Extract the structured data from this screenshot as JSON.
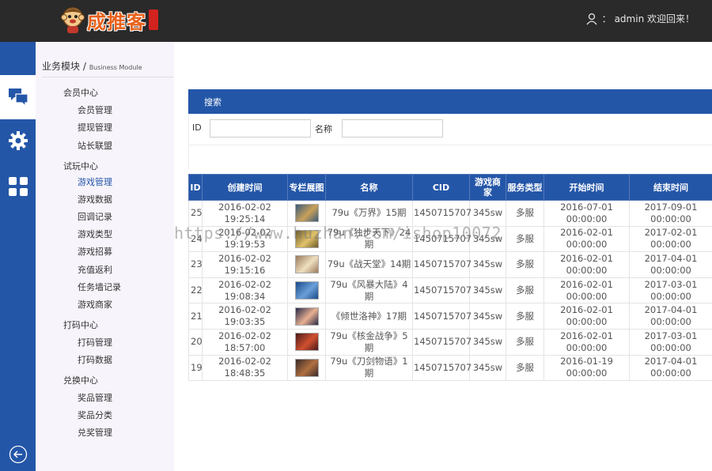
{
  "header": {
    "logo_text": "成推客",
    "user_text": "admin 欢迎回来！",
    "user_prefix": "："
  },
  "sidebar": {
    "title": "业务模块 /",
    "subtitle": "Business Module",
    "groups": [
      {
        "label": "会员中心",
        "items": [
          "会员管理",
          "提现管理",
          "站长联盟"
        ]
      },
      {
        "label": "试玩中心",
        "items": [
          "游戏管理",
          "游戏数据",
          "回调记录",
          "游戏类型",
          "游戏招募",
          "充值返利",
          "任务墙记录",
          "游戏商家"
        ]
      },
      {
        "label": "打码中心",
        "items": [
          "打码管理",
          "打码数据"
        ]
      },
      {
        "label": "兑换中心",
        "items": [
          "奖品管理",
          "奖品分类",
          "兑奖管理"
        ]
      }
    ]
  },
  "search": {
    "title": "搜索",
    "id_label": "ID",
    "name_label": "名称",
    "id_value": "",
    "name_value": ""
  },
  "table": {
    "headers": [
      "ID",
      "创建时间",
      "专栏展图",
      "名称",
      "CID",
      "游戏商家",
      "服务类型",
      "开始时间",
      "结束时间"
    ],
    "rows": [
      {
        "id": "25",
        "created": "2016-02-02 19:25:14",
        "name": "79u《万界》15期",
        "cid": "1450715707",
        "merchant": "345sw",
        "service": "多服",
        "start": "2016-07-01 00:00:00",
        "end": "2017-09-01 00:00:00"
      },
      {
        "id": "24",
        "created": "2016-02-02 19:19:53",
        "name": "79u《独步天下》24期",
        "cid": "1450715707",
        "merchant": "345sw",
        "service": "多服",
        "start": "2016-02-01 00:00:00",
        "end": "2017-02-01 00:00:00"
      },
      {
        "id": "23",
        "created": "2016-02-02 19:15:16",
        "name": "79u《战天堂》14期",
        "cid": "1450715707",
        "merchant": "345sw",
        "service": "多服",
        "start": "2016-02-01 00:00:00",
        "end": "2017-04-01 00:00:00"
      },
      {
        "id": "22",
        "created": "2016-02-02 19:08:34",
        "name": "79u《风暴大陆》4期",
        "cid": "1450715707",
        "merchant": "345sw",
        "service": "多服",
        "start": "2016-02-01 00:00:00",
        "end": "2017-03-01 00:00:00"
      },
      {
        "id": "21",
        "created": "2016-02-02 19:03:35",
        "name": "《倾世洛神》17期",
        "cid": "1450715707",
        "merchant": "345sw",
        "service": "多服",
        "start": "2016-02-01 00:00:00",
        "end": "2017-04-01 00:00:00"
      },
      {
        "id": "20",
        "created": "2016-02-02 18:57:00",
        "name": "79u《核金战争》5期",
        "cid": "1450715707",
        "merchant": "345sw",
        "service": "多服",
        "start": "2016-02-01 00:00:00",
        "end": "2017-03-01 00:00:00"
      },
      {
        "id": "19",
        "created": "2016-02-02 18:48:35",
        "name": "79u《刀剑物语》1期",
        "cid": "1450715707",
        "merchant": "345sw",
        "service": "多服",
        "start": "2016-01-19 00:00:00",
        "end": "2017-04-01 00:00:00"
      }
    ]
  },
  "watermark": "https://www.huzhan.com/ishop10072",
  "colors": {
    "topbar": "#2a2a2a",
    "accent": "#2456a8",
    "sidebar_bg": "#f8f4fb"
  },
  "icons": {
    "chat": "chat-bubbles-icon",
    "settings": "gear-icon",
    "apps": "grid-icon",
    "back": "back-arrow-icon",
    "user": "user-icon"
  }
}
